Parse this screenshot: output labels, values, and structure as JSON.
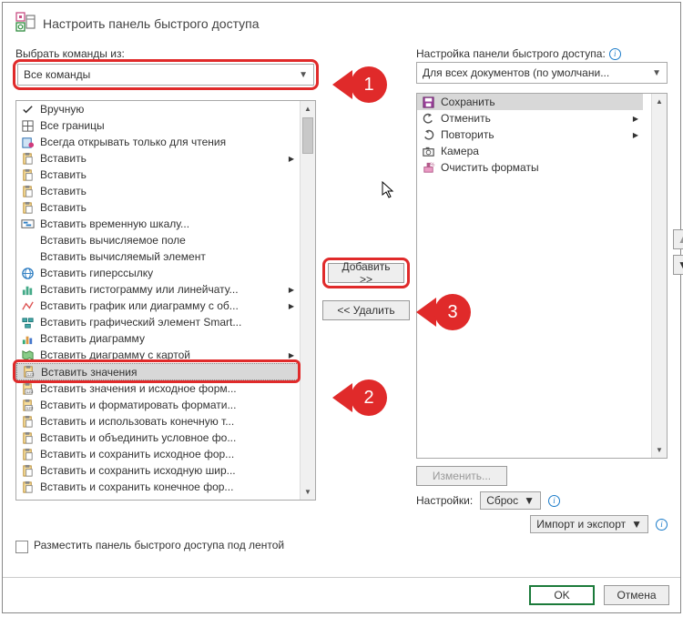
{
  "title": "Настроить панель быстрого доступа",
  "left_label": "Выбрать команды из:",
  "left_dropdown": "Все команды",
  "right_label": "Настройка панели быстрого доступа:",
  "right_dropdown": "Для всех документов (по умолчани...",
  "add_button": "Добавить >>",
  "remove_button": "<< Удалить",
  "modify_button": "Изменить...",
  "reset_label": "Настройки:",
  "reset_button": "Сброс",
  "import_export_button": "Импорт и экспорт",
  "checkbox_label": "Разместить панель быстрого доступа под лентой",
  "ok_button": "OK",
  "cancel_button": "Отмена",
  "callouts": {
    "c1": "1",
    "c2": "2",
    "c3": "3"
  },
  "left_items": [
    {
      "label": "Вручную",
      "icon": "check",
      "sub": false
    },
    {
      "label": "Все границы",
      "icon": "borders",
      "sub": false
    },
    {
      "label": "Всегда открывать только для чтения",
      "icon": "readonly",
      "sub": false
    },
    {
      "label": "Вставить",
      "icon": "paste1",
      "sub": true
    },
    {
      "label": "Вставить",
      "icon": "paste2",
      "sub": false
    },
    {
      "label": "Вставить",
      "icon": "paste3",
      "sub": false
    },
    {
      "label": "Вставить",
      "icon": "paste4",
      "sub": false
    },
    {
      "label": "Вставить временную шкалу...",
      "icon": "timeline",
      "sub": false
    },
    {
      "label": "Вставить вычисляемое поле",
      "icon": "blank",
      "sub": false
    },
    {
      "label": "Вставить вычисляемый элемент",
      "icon": "blank",
      "sub": false
    },
    {
      "label": "Вставить гиперссылку",
      "icon": "link",
      "sub": false
    },
    {
      "label": "Вставить гистограмму или линейчату...",
      "icon": "histo",
      "sub": true
    },
    {
      "label": "Вставить график или диаграмму с об...",
      "icon": "line",
      "sub": true
    },
    {
      "label": "Вставить графический элемент Smart...",
      "icon": "smart",
      "sub": false
    },
    {
      "label": "Вставить диаграмму",
      "icon": "chart",
      "sub": false
    },
    {
      "label": "Вставить диаграмму с картой",
      "icon": "map",
      "sub": true
    },
    {
      "label": "Вставить значения",
      "icon": "values",
      "sub": false,
      "selected": true
    },
    {
      "label": "Вставить значения и исходное форм...",
      "icon": "values2",
      "sub": false
    },
    {
      "label": "Вставить и форматировать формати...",
      "icon": "values3",
      "sub": false
    },
    {
      "label": "Вставить и использовать конечную т...",
      "icon": "paste5",
      "sub": false
    },
    {
      "label": "Вставить и объединить условное фо...",
      "icon": "paste6",
      "sub": false
    },
    {
      "label": "Вставить и сохранить исходное фор...",
      "icon": "paste7",
      "sub": false
    },
    {
      "label": "Вставить и сохранить исходную шир...",
      "icon": "paste8",
      "sub": false
    },
    {
      "label": "Вставить и сохранить конечное фор...",
      "icon": "paste9",
      "sub": false
    }
  ],
  "right_items": [
    {
      "label": "Сохранить",
      "icon": "save",
      "sub": false,
      "selected": true
    },
    {
      "label": "Отменить",
      "icon": "undo",
      "sub": true
    },
    {
      "label": "Повторить",
      "icon": "redo",
      "sub": true
    },
    {
      "label": "Камера",
      "icon": "camera",
      "sub": false
    },
    {
      "label": "Очистить форматы",
      "icon": "clear",
      "sub": false
    }
  ]
}
